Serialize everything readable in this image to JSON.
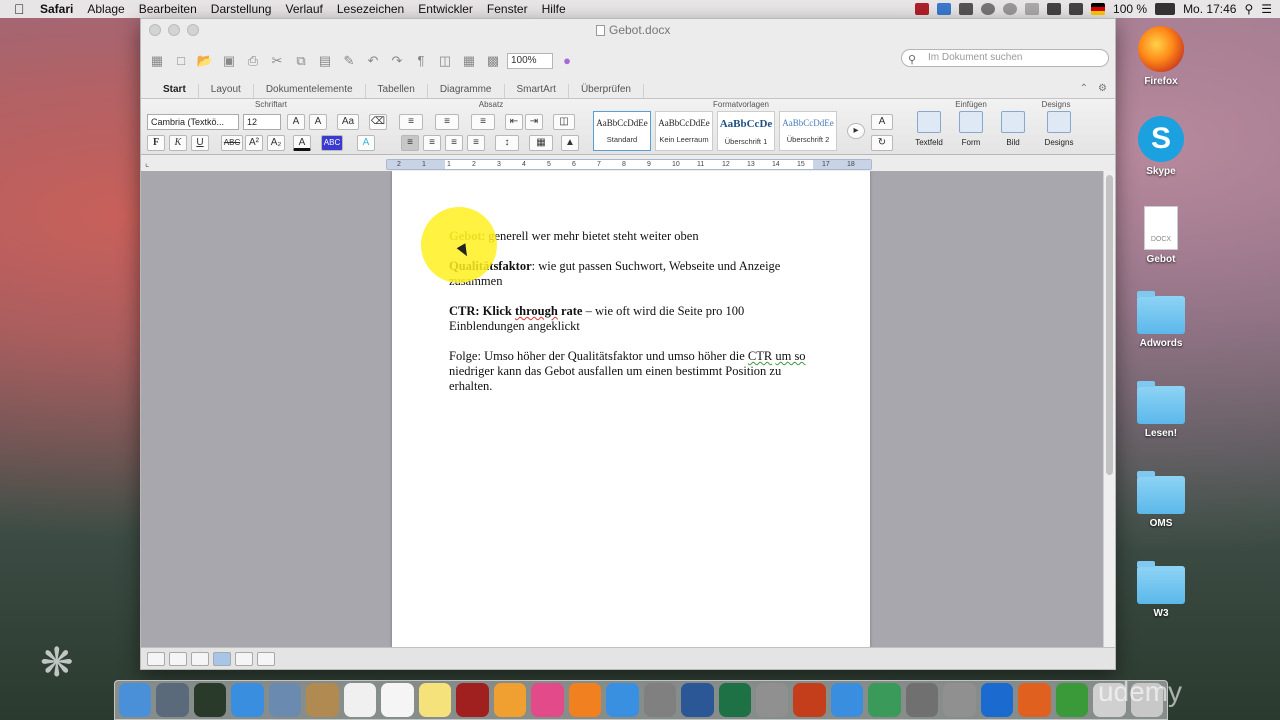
{
  "menubar": {
    "app": "Safari",
    "items": [
      "Ablage",
      "Bearbeiten",
      "Darstellung",
      "Verlauf",
      "Lesezeichen",
      "Entwickler",
      "Fenster",
      "Hilfe"
    ],
    "battery": "100 %",
    "clock": "Mo. 17:46"
  },
  "window": {
    "title": "Gebot.docx",
    "zoom": "100%",
    "search_placeholder": "Im Dokument suchen"
  },
  "ribbon": {
    "tabs": [
      "Start",
      "Layout",
      "Dokumentelemente",
      "Tabellen",
      "Diagramme",
      "SmartArt",
      "Überprüfen"
    ],
    "groups": {
      "font": "Schriftart",
      "paragraph": "Absatz",
      "styles": "Formatvorlagen",
      "insert": "Einfügen",
      "designs": "Designs"
    },
    "font_name": "Cambria (Textkö...",
    "font_size": "12",
    "styles": [
      {
        "sample": "AaBbCcDdEe",
        "name": "Standard"
      },
      {
        "sample": "AaBbCcDdEe",
        "name": "Kein Leerraum"
      },
      {
        "sample": "AaBbCcDe",
        "name": "Überschrift 1"
      },
      {
        "sample": "AaBbCcDdEe",
        "name": "Überschrift 2"
      }
    ],
    "insert_items": [
      "Textfeld",
      "Form",
      "Bild"
    ],
    "designs_label": "Designs"
  },
  "ruler": {
    "labels": [
      "2",
      "1",
      "1",
      "2",
      "3",
      "4",
      "5",
      "6",
      "7",
      "8",
      "9",
      "10",
      "11",
      "12",
      "13",
      "14",
      "15",
      "17",
      "18"
    ]
  },
  "document": {
    "p1_term": "Gebot",
    "p1_text": ": generell wer mehr bietet steht weiter oben",
    "p2_term": "Qualitätsfaktor",
    "p2_text": ": wie gut passen Suchwort, Webseite und Anzeige zusammen",
    "p3_term_a": "CTR: Klick ",
    "p3_term_b": "through",
    "p3_term_c": " rate",
    "p3_text": " – wie oft wird die Seite pro 100 Einblendungen angeklickt",
    "p4_text_a": "Folge: Umso höher der Qualitätsfaktor und umso höher die ",
    "p4_ctr": "CTR",
    "p4_text_b": " ",
    "p4_umso": "um so",
    "p4_text_c": " niedriger kann das Gebot ausfallen um einen bestimmt Position zu erhalten."
  },
  "desktop": {
    "icons": [
      {
        "label": "Firefox"
      },
      {
        "label": "Skype"
      },
      {
        "label": "Gebot",
        "ext": "DOCX"
      },
      {
        "label": "Adwords"
      },
      {
        "label": "Lesen!"
      },
      {
        "label": "OMS"
      },
      {
        "label": "W3"
      }
    ]
  },
  "dock": {
    "watermark": "udemy",
    "items": [
      {
        "icon": "finder-icon",
        "color": "#4a90d9"
      },
      {
        "icon": "launchpad-icon",
        "color": "#5a6a7a"
      },
      {
        "icon": "mission-control-icon",
        "color": "#2a3a2a"
      },
      {
        "icon": "safari-icon",
        "color": "#3a8ee0"
      },
      {
        "icon": "preview-icon",
        "color": "#6a8ab0"
      },
      {
        "icon": "contacts-icon",
        "color": "#b08a50"
      },
      {
        "icon": "calendar-icon",
        "color": "#f0f0f0"
      },
      {
        "icon": "reminders-icon",
        "color": "#f5f5f5"
      },
      {
        "icon": "notes-icon",
        "color": "#f5e27a"
      },
      {
        "icon": "photo-booth-icon",
        "color": "#a02020"
      },
      {
        "icon": "photos-icon",
        "color": "#f0a030"
      },
      {
        "icon": "itunes-icon",
        "color": "#e24a8a"
      },
      {
        "icon": "ibooks-icon",
        "color": "#f08020"
      },
      {
        "icon": "app-store-icon",
        "color": "#3a90e0"
      },
      {
        "icon": "system-preferences-icon",
        "color": "#808080"
      },
      {
        "icon": "word-icon",
        "color": "#2b5797"
      },
      {
        "icon": "excel-icon",
        "color": "#1e7145"
      },
      {
        "icon": "unknown-app-icon",
        "color": "#909090"
      },
      {
        "icon": "powerpoint-icon",
        "color": "#c43e1c"
      },
      {
        "icon": "messenger-icon",
        "color": "#3a8ee0"
      },
      {
        "icon": "network-icon",
        "color": "#3a9a5a"
      },
      {
        "icon": "utilities-icon",
        "color": "#707070"
      },
      {
        "icon": "unknown-app-icon-2",
        "color": "#909090"
      },
      {
        "icon": "teamviewer-icon",
        "color": "#1a6ad0"
      },
      {
        "icon": "firefox-dock-icon",
        "color": "#e06020"
      },
      {
        "icon": "camtasia-icon",
        "color": "#3a9a3a"
      },
      {
        "icon": "downloads-icon",
        "color": "#d0d0d0"
      },
      {
        "icon": "trash-icon",
        "color": "#c8c8c8"
      }
    ]
  }
}
